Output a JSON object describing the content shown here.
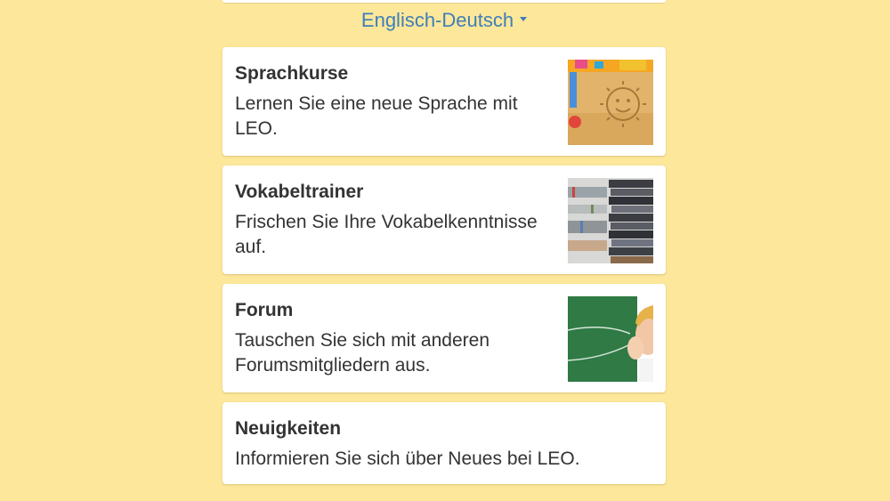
{
  "language_selector": {
    "label": "Englisch-Deutsch"
  },
  "cards": [
    {
      "title": "Sprachkurse",
      "description": "Lernen Sie eine neue Sprache mit LEO.",
      "image": "sun-in-sand-photo"
    },
    {
      "title": "Vokabeltrainer",
      "description": "Frischen Sie Ihre Vokabelkenntnisse auf.",
      "image": "book-stack-photo"
    },
    {
      "title": "Forum",
      "description": "Tauschen Sie sich mit anderen Forumsmitgliedern aus.",
      "image": "child-at-chalkboard-photo"
    },
    {
      "title": "Neuigkeiten",
      "description": "Informieren Sie sich über Neues bei LEO."
    }
  ],
  "colors": {
    "background": "#fde79a",
    "link": "#3e7fb8",
    "text": "#333333",
    "card": "#ffffff"
  }
}
